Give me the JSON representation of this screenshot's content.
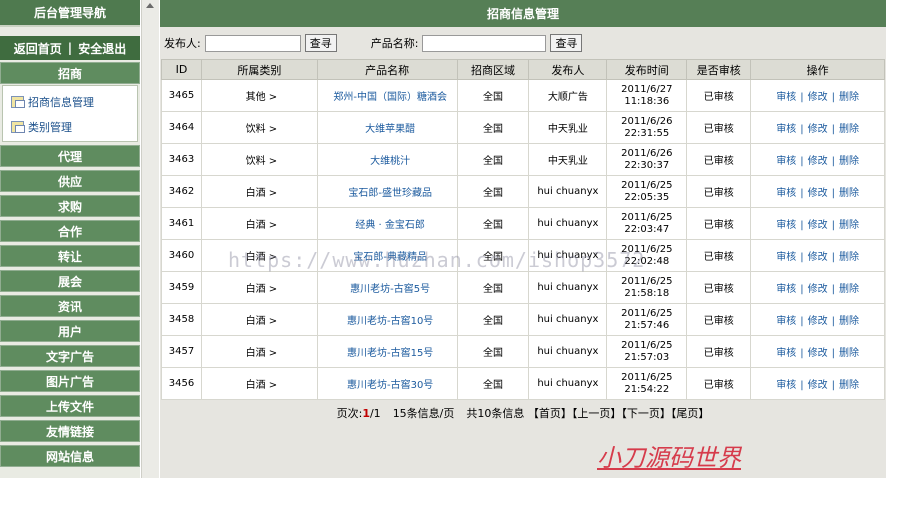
{
  "sidebar": {
    "title": "后台管理导航",
    "home_link": "返回首页",
    "divider": "|",
    "logout_link": "安全退出",
    "active_category": "招商",
    "sub_items": [
      "招商信息管理",
      "类别管理"
    ],
    "categories": [
      "代理",
      "供应",
      "求购",
      "合作",
      "转让",
      "展会",
      "资讯",
      "用户",
      "文字广告",
      "图片广告",
      "上传文件",
      "友情链接",
      "网站信息"
    ]
  },
  "main": {
    "title": "招商信息管理",
    "search": {
      "publisher_label": "发布人:",
      "publisher_value": "",
      "search_btn": "查寻",
      "product_label": "产品名称:",
      "product_value": "",
      "search_btn2": "查寻"
    },
    "columns": [
      "ID",
      "所属类别",
      "产品名称",
      "招商区域",
      "发布人",
      "发布时间",
      "是否审核",
      "操作"
    ],
    "rows": [
      {
        "id": "3465",
        "category": "其他 >",
        "product": "郑州-中国（国际）糖酒会",
        "region": "全国",
        "publisher": "大顺广告",
        "date": "2011/6/27",
        "time": "11:18:36",
        "status": "已审核"
      },
      {
        "id": "3464",
        "category": "饮料 >",
        "product": "大维苹果醋",
        "region": "全国",
        "publisher": "中天乳业",
        "date": "2011/6/26",
        "time": "22:31:55",
        "status": "已审核"
      },
      {
        "id": "3463",
        "category": "饮料 >",
        "product": "大维桃汁",
        "region": "全国",
        "publisher": "中天乳业",
        "date": "2011/6/26",
        "time": "22:30:37",
        "status": "已审核"
      },
      {
        "id": "3462",
        "category": "白酒 >",
        "product": "宝石郎-盛世珍藏品",
        "region": "全国",
        "publisher": "hui chuanyx",
        "date": "2011/6/25",
        "time": "22:05:35",
        "status": "已审核"
      },
      {
        "id": "3461",
        "category": "白酒 >",
        "product": "经典 · 金宝石郎",
        "region": "全国",
        "publisher": "hui chuanyx",
        "date": "2011/6/25",
        "time": "22:03:47",
        "status": "已审核"
      },
      {
        "id": "3460",
        "category": "白酒 >",
        "product": "宝石郎-典藏精品",
        "region": "全国",
        "publisher": "hui chuanyx",
        "date": "2011/6/25",
        "time": "22:02:48",
        "status": "已审核"
      },
      {
        "id": "3459",
        "category": "白酒 >",
        "product": "惠川老坊-古窖5号",
        "region": "全国",
        "publisher": "hui chuanyx",
        "date": "2011/6/25",
        "time": "21:58:18",
        "status": "已审核"
      },
      {
        "id": "3458",
        "category": "白酒 >",
        "product": "惠川老坊-古窖10号",
        "region": "全国",
        "publisher": "hui chuanyx",
        "date": "2011/6/25",
        "time": "21:57:46",
        "status": "已审核"
      },
      {
        "id": "3457",
        "category": "白酒 >",
        "product": "惠川老坊-古窖15号",
        "region": "全国",
        "publisher": "hui chuanyx",
        "date": "2011/6/25",
        "time": "21:57:03",
        "status": "已审核"
      },
      {
        "id": "3456",
        "category": "白酒 >",
        "product": "惠川老坊-古窖30号",
        "region": "全国",
        "publisher": "hui chuanyx",
        "date": "2011/6/25",
        "time": "21:54:22",
        "status": "已审核"
      }
    ],
    "ops": {
      "review": "审核",
      "edit": "修改",
      "delete": "删除",
      "sep": "|"
    },
    "pager": {
      "page_label": "页次:",
      "page_current": "1",
      "page_total": "/1",
      "per_page": "15条信息/页",
      "total": "共10条信息",
      "first": "【首页】",
      "prev": "【上一页】",
      "next": "【下一页】",
      "last": "【尾页】"
    }
  },
  "overlay": {
    "watermark": "https://www.huzhan.com/ishop3572",
    "brand": "小刀源码世界"
  },
  "colors": {
    "header_green": "#567f56",
    "link_blue": "#1b5a9e",
    "page_red": "#c00000",
    "brand_red": "#d63b4b"
  }
}
